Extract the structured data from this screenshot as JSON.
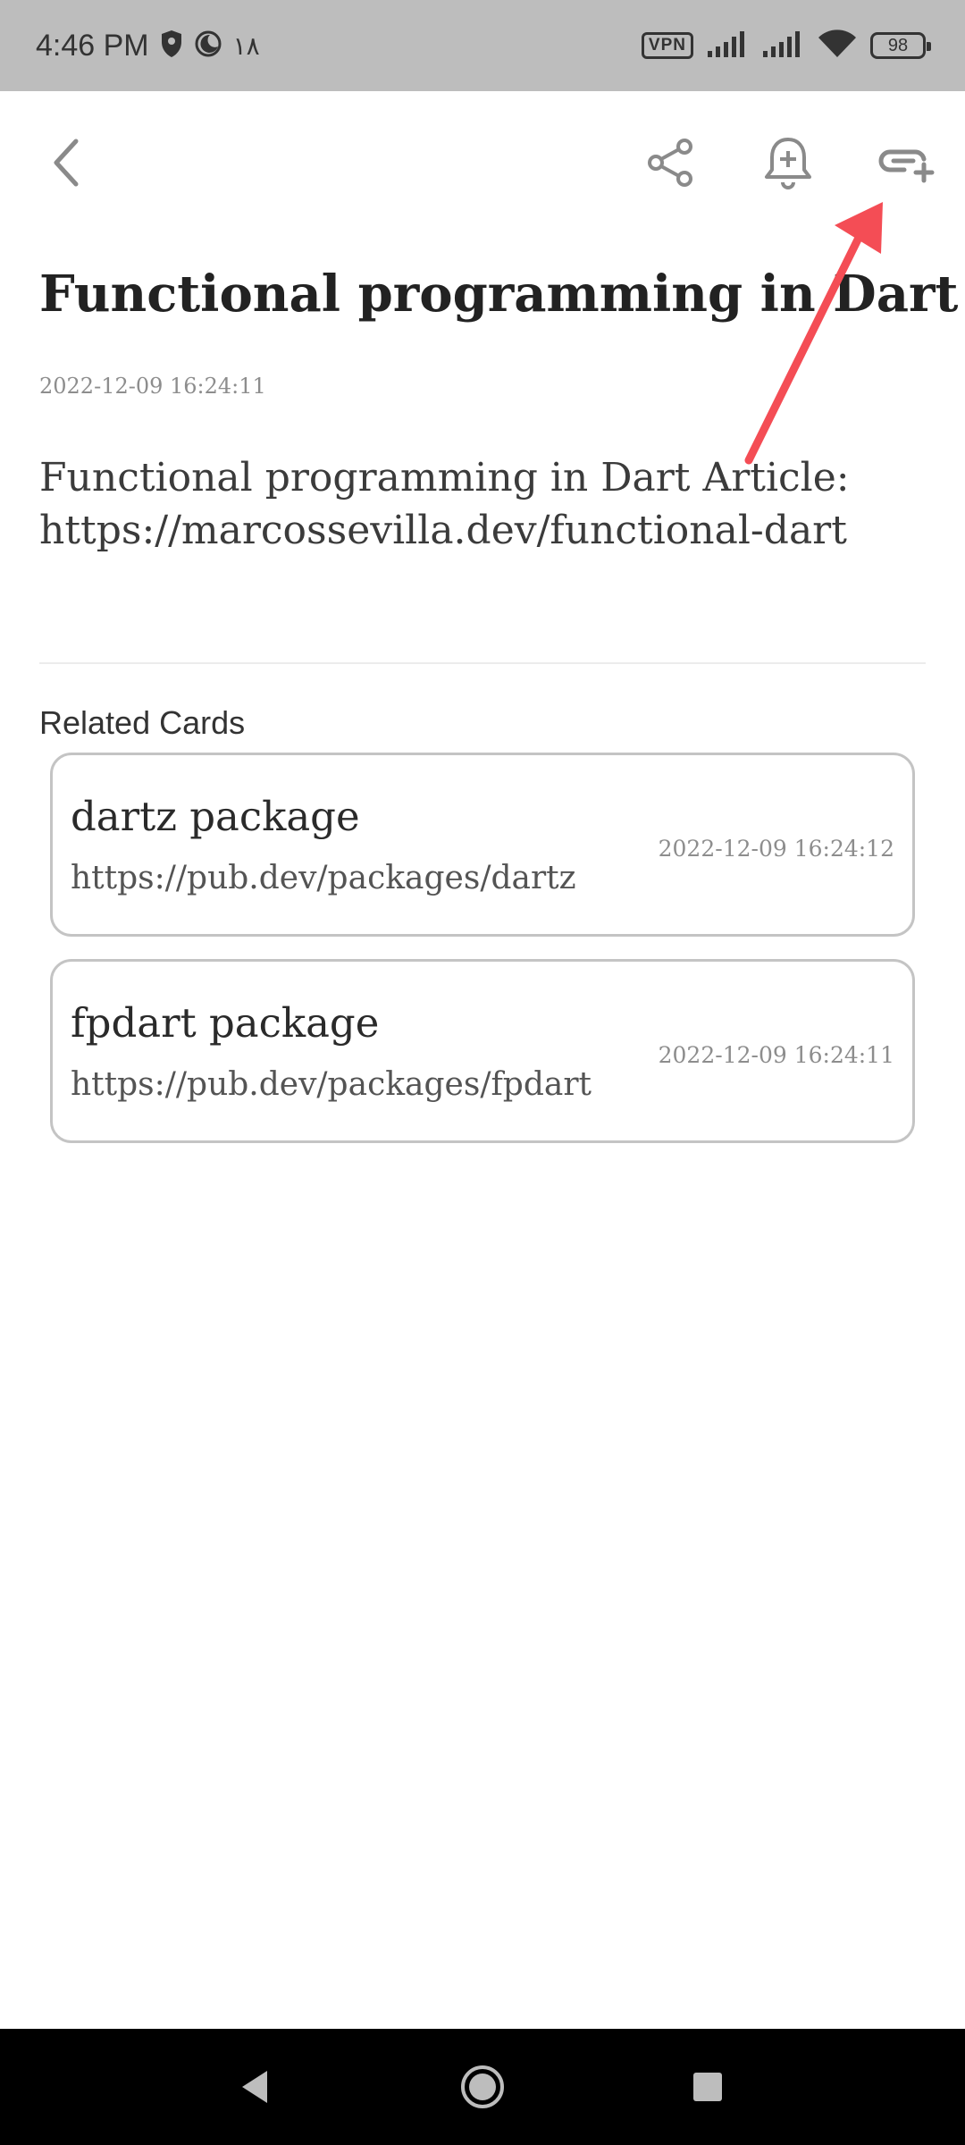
{
  "status_bar": {
    "time": "4:46 PM",
    "extra_indicator": "١٨",
    "vpn_label": "VPN",
    "battery_level": "98",
    "icons": [
      "shield-icon",
      "moon-icon",
      "vpn-icon",
      "signal-icon",
      "wifi-icon",
      "battery-icon"
    ]
  },
  "app_bar": {
    "icons": [
      "back-icon",
      "share-icon",
      "add-reminder-icon",
      "add-link-icon"
    ]
  },
  "article": {
    "title": "Functional programming in Dart",
    "date": "2022-12-09 16:24:11",
    "body_line1": "Functional programming in Dart Article:",
    "body_line2": "https://marcossevilla.dev/functional-dart"
  },
  "related": {
    "heading": "Related Cards",
    "cards": [
      {
        "title": "dartz package",
        "url": "https://pub.dev/packages/dartz",
        "date": "2022-12-09 16:24:12"
      },
      {
        "title": "fpdart package",
        "url": "https://pub.dev/packages/fpdart",
        "date": "2022-12-09 16:24:11"
      }
    ]
  },
  "colors": {
    "annotation_arrow": "#f44d55",
    "status_bar_bg": "#bdbdbd",
    "icon_gray": "#8a8a8a",
    "card_border": "#c4c4c4"
  },
  "nav_bar": {
    "icons": [
      "nav-back-icon",
      "nav-home-icon",
      "nav-recents-icon"
    ]
  }
}
